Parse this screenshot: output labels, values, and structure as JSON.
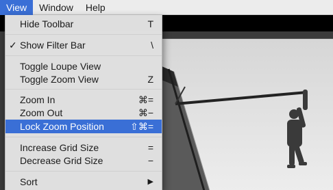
{
  "menubar": {
    "items": [
      "View",
      "Window",
      "Help"
    ]
  },
  "view_menu": {
    "hide_toolbar": {
      "label": "Hide Toolbar",
      "shortcut": "T"
    },
    "show_filter_bar": {
      "label": "Show Filter Bar",
      "shortcut": "\\",
      "check": "✓"
    },
    "toggle_loupe": {
      "label": "Toggle Loupe View",
      "shortcut": ""
    },
    "toggle_zoom": {
      "label": "Toggle Zoom View",
      "shortcut": "Z"
    },
    "zoom_in": {
      "label": "Zoom In",
      "shortcut": "⌘="
    },
    "zoom_out": {
      "label": "Zoom Out",
      "shortcut": "⌘−"
    },
    "lock_zoom": {
      "label": "Lock Zoom Position",
      "shortcut": "⇧⌘="
    },
    "increase_grid": {
      "label": "Increase Grid Size",
      "shortcut": "="
    },
    "decrease_grid": {
      "label": "Decrease Grid Size",
      "shortcut": "−"
    },
    "sort": {
      "label": "Sort",
      "shortcut": "▶"
    }
  },
  "colors": {
    "highlight": "#3a6fd6",
    "menu_bg": "#e2e2e2"
  }
}
